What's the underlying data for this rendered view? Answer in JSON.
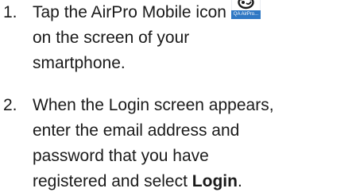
{
  "steps": [
    {
      "number": "1.",
      "line_1_before_icon": "Tap the AirPro Mobile icon",
      "icon": {
        "name": "airpro-mobile-app-icon",
        "caption": "QA AirPro...",
        "color": "#2f78c4"
      },
      "line_2": "on the screen of your",
      "line_3": "smartphone."
    },
    {
      "number": "2.",
      "line_1": "When the Login screen appears,",
      "line_2": "enter the email address and",
      "line_3": "password that you have",
      "line_4_before_bold": "registered and select ",
      "line_4_bold": "Login",
      "line_4_after_bold": "."
    }
  ]
}
